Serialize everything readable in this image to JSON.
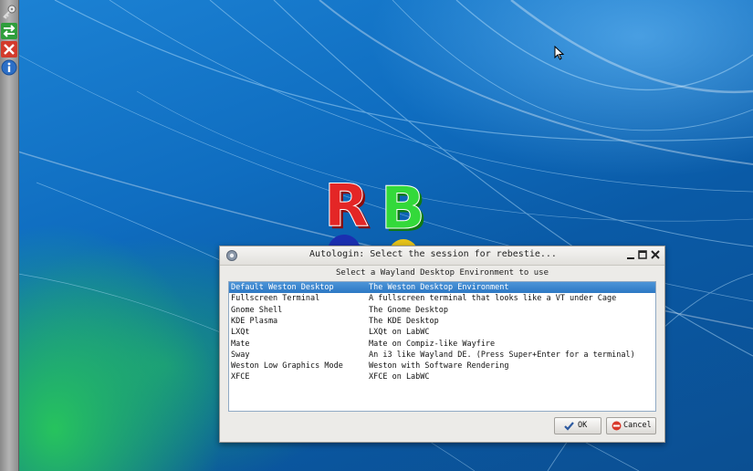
{
  "desktop": {
    "wallpaper": "blue-green-light-streaks",
    "accent": "#0f6dc0"
  },
  "side_panel": {
    "launchers": [
      {
        "icon": "key-icon"
      },
      {
        "icon": "switch-arrows-icon"
      },
      {
        "icon": "red-x-icon"
      },
      {
        "icon": "info-icon"
      }
    ]
  },
  "logo": {
    "letters": [
      "R",
      "B"
    ]
  },
  "dialog": {
    "title": "Autologin: Select the session for rebestie...",
    "prompt": "Select a Wayland Desktop Environment to use",
    "sessions": [
      {
        "name": "Default Weston Desktop",
        "description": "The Weston Desktop Environment",
        "selected": true
      },
      {
        "name": "Fullscreen Terminal",
        "description": "A fullscreen terminal that looks like a VT under Cage",
        "selected": false
      },
      {
        "name": "Gnome Shell",
        "description": "The Gnome Desktop",
        "selected": false
      },
      {
        "name": "KDE Plasma",
        "description": "The KDE Desktop",
        "selected": false
      },
      {
        "name": "LXQt",
        "description": "LXQt on LabWC",
        "selected": false
      },
      {
        "name": "Mate",
        "description": "Mate on Compiz-like Wayfire",
        "selected": false
      },
      {
        "name": "Sway",
        "description": "An i3 like Wayland DE. (Press Super+Enter for a terminal)",
        "selected": false
      },
      {
        "name": "Weston Low Graphics Mode",
        "description": "Weston with Software Rendering",
        "selected": false
      },
      {
        "name": "XFCE",
        "description": "XFCE on LabWC",
        "selected": false
      }
    ],
    "ok_label": "OK",
    "cancel_label": "Cancel",
    "selection_color": "#3a86cf"
  }
}
